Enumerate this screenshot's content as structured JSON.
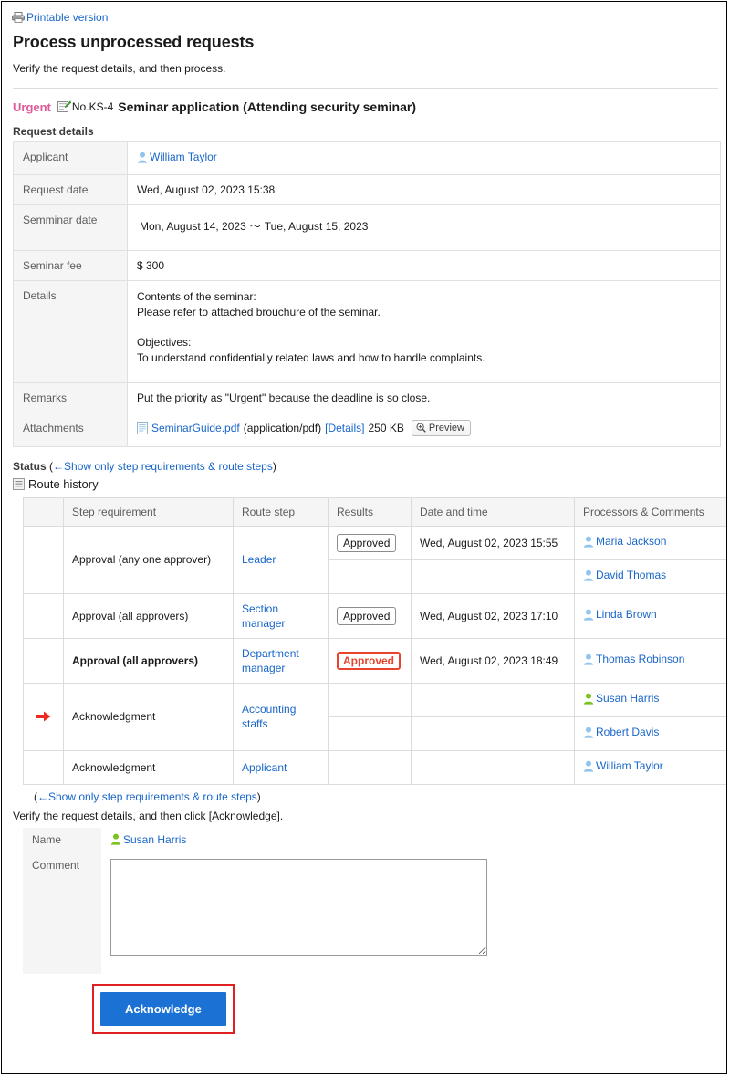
{
  "top": {
    "printable_label": "Printable version",
    "printable_icon": "printer-icon"
  },
  "header": {
    "title": "Process unprocessed requests",
    "description": "Verify the request details, and then process."
  },
  "request_headline": {
    "priority": "Urgent",
    "form_icon": "form-icon",
    "number": "No.KS-4",
    "subject": "Seminar application (Attending security seminar)"
  },
  "request_details": {
    "section_label": "Request details",
    "rows": [
      {
        "label": "Applicant",
        "type": "user",
        "user": "William Taylor",
        "user_icon": "user-blue-icon"
      },
      {
        "label": "Request date",
        "type": "text",
        "value": "Wed, August 02, 2023 15:38"
      },
      {
        "label": "Semminar date",
        "type": "range",
        "start": "Mon, August 14, 2023",
        "separator": "〜",
        "end": "Tue, August 15, 2023"
      },
      {
        "label": "Seminar fee",
        "type": "text",
        "value": "$ 300"
      },
      {
        "label": "Details",
        "type": "multiline",
        "lines": [
          "Contents of the seminar:",
          "Please refer to attached brouchure of the seminar.",
          "",
          "Objectives:",
          "To understand confidentially related laws and how to handle complaints."
        ]
      },
      {
        "label": "Remarks",
        "type": "text",
        "value": "Put the priority as \"Urgent\" because the deadline is so close."
      },
      {
        "label": "Attachments",
        "type": "file",
        "file_icon": "file-icon",
        "filename": "SeminarGuide.pdf",
        "mime": "(application/pdf)",
        "details_link": "[Details]",
        "size": "250 KB",
        "preview_label": "Preview",
        "preview_icon": "zoom-in-icon"
      }
    ]
  },
  "status": {
    "label": "Status",
    "toggle_link": "←Show only step requirements & route steps",
    "open_paren": "(",
    "close_paren": ")",
    "route_history_label": "Route history",
    "route_history_icon": "list-icon",
    "columns": [
      "",
      "Step requirement",
      "Route step",
      "Results",
      "Date and time",
      "Processors & Comments"
    ],
    "rows": [
      {
        "current": false,
        "highlight": false,
        "step_requirement": "Approval (any one approver)",
        "route_step": "Leader",
        "processors": [
          {
            "name": "Maria Jackson",
            "icon": "user-blue-icon",
            "result": "Approved",
            "result_style": "normal",
            "datetime": "Wed, August 02, 2023 15:55"
          },
          {
            "name": "David Thomas",
            "icon": "user-blue-icon",
            "result": "",
            "result_style": "none",
            "datetime": ""
          }
        ]
      },
      {
        "current": false,
        "highlight": false,
        "step_requirement": "Approval (all approvers)",
        "route_step": "Section manager",
        "processors": [
          {
            "name": "Linda Brown",
            "icon": "user-blue-icon",
            "result": "Approved",
            "result_style": "normal",
            "datetime": "Wed, August 02, 2023 17:10"
          }
        ]
      },
      {
        "current": false,
        "highlight": true,
        "step_requirement": "Approval (all approvers)",
        "route_step": "Department manager",
        "processors": [
          {
            "name": "Thomas Robinson",
            "icon": "user-blue-icon",
            "result": "Approved",
            "result_style": "red",
            "datetime": "Wed, August 02, 2023 18:49"
          }
        ]
      },
      {
        "current": true,
        "current_icon": "red-arrow-icon",
        "highlight": false,
        "step_requirement": "Acknowledgment",
        "route_step": "Accounting staffs",
        "processors": [
          {
            "name": "Susan Harris",
            "icon": "user-green-icon",
            "result": "",
            "result_style": "none",
            "datetime": ""
          },
          {
            "name": "Robert Davis",
            "icon": "user-blue-icon",
            "result": "",
            "result_style": "none",
            "datetime": ""
          }
        ]
      },
      {
        "current": false,
        "highlight": false,
        "step_requirement": "Acknowledgment",
        "route_step": "Applicant",
        "processors": [
          {
            "name": "William Taylor",
            "icon": "user-blue-icon",
            "result": "",
            "result_style": "none",
            "datetime": ""
          }
        ]
      }
    ],
    "bottom_toggle_link": "←Show only step requirements & route steps"
  },
  "action_form": {
    "instruction": "Verify the request details, and then click [Acknowledge].",
    "name_label": "Name",
    "name_value": "Susan Harris",
    "name_icon": "user-green-icon",
    "comment_label": "Comment",
    "comment_value": "",
    "comment_placeholder": "",
    "submit_label": "Acknowledge"
  },
  "colors": {
    "link": "#1866c9",
    "urgent": "#e05a9a",
    "highlight_row": "#fbf5d0",
    "badge_red": "#e8442c",
    "button_blue": "#1b72d4",
    "focus_outline": "#e02020",
    "label_bg": "#f5f5f5"
  }
}
